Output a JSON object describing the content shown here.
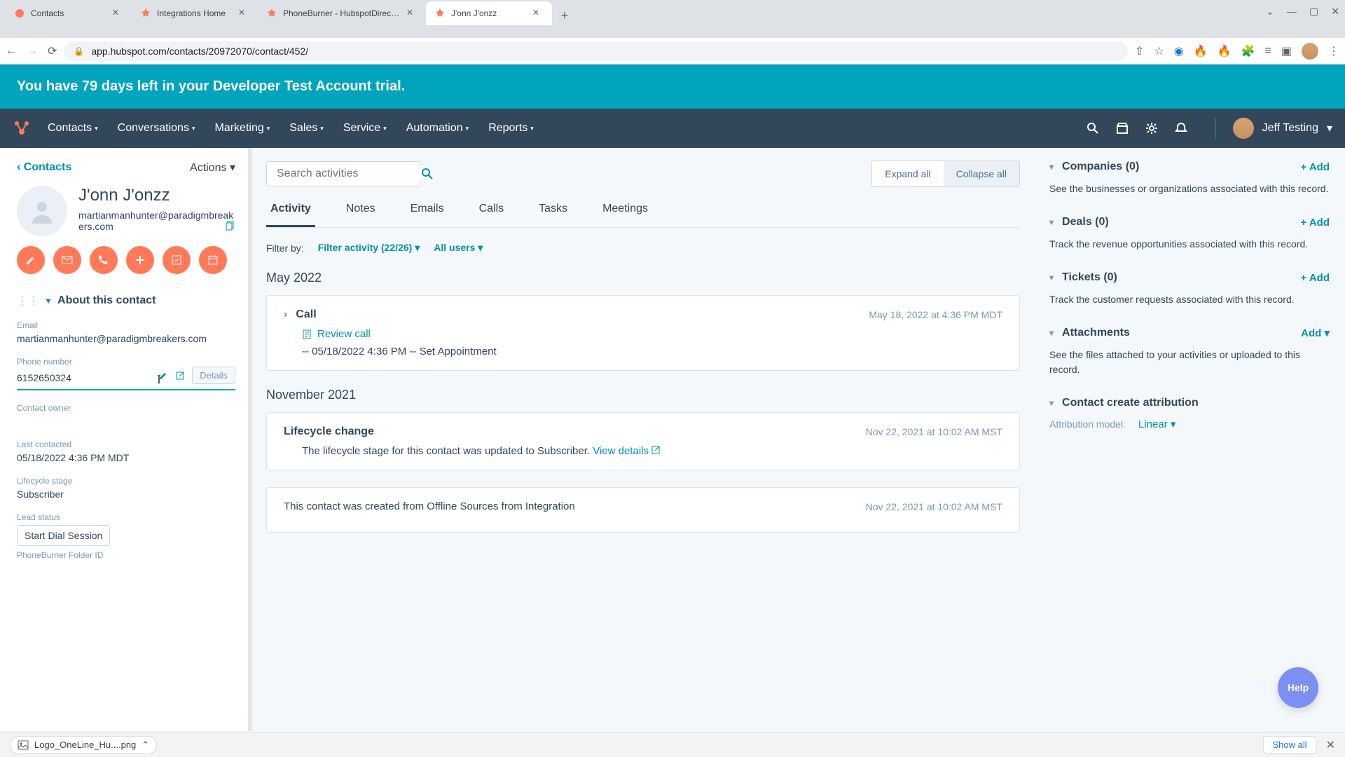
{
  "browser": {
    "tabs": [
      {
        "title": "Contacts"
      },
      {
        "title": "Integrations Home"
      },
      {
        "title": "PhoneBurner - HubspotDirect Ac"
      },
      {
        "title": "J'onn J'onzz"
      }
    ],
    "active_tab": 3,
    "url": "app.hubspot.com/contacts/20972070/contact/452/",
    "download": {
      "file": "Logo_OneLine_Hu....png",
      "show_all": "Show all"
    }
  },
  "banner": "You have 79 days left in your Developer Test Account trial.",
  "nav": {
    "items": [
      "Contacts",
      "Conversations",
      "Marketing",
      "Sales",
      "Service",
      "Automation",
      "Reports"
    ],
    "account": "Jeff Testing"
  },
  "sidebar": {
    "back": "Contacts",
    "actions": "Actions",
    "name": "J'onn J'onzz",
    "email_top": "martianmanhunter@paradigmbreakers.com",
    "about_heading": "About this contact",
    "fields": {
      "email_label": "Email",
      "email_value": "martianmanhunter@paradigmbreakers.com",
      "phone_label": "Phone number",
      "phone_value": "6152650324",
      "details_btn": "Details",
      "owner_label": "Contact owner",
      "last_contacted_label": "Last contacted",
      "last_contacted_value": "05/18/2022 4:36 PM MDT",
      "lifecycle_label": "Lifecycle stage",
      "lifecycle_value": "Subscriber",
      "lead_status_label": "Lead status",
      "dial_btn": "Start Dial Session",
      "folder_label": "PhoneBurner Folder ID"
    }
  },
  "center": {
    "search_placeholder": "Search activities",
    "expand": "Expand all",
    "collapse": "Collapse all",
    "tabs": [
      "Activity",
      "Notes",
      "Emails",
      "Calls",
      "Tasks",
      "Meetings"
    ],
    "filter_label": "Filter by:",
    "filter_activity": "Filter activity (22/26)",
    "all_users": "All users",
    "months": {
      "m1": "May 2022",
      "m2": "November 2021"
    },
    "cards": {
      "call": {
        "title": "Call",
        "date": "May 18, 2022 at 4:36 PM MDT",
        "review": "Review call",
        "body": "-- 05/18/2022 4:36 PM -- Set Appointment"
      },
      "lifecycle": {
        "title": "Lifecycle change",
        "date": "Nov 22, 2021 at 10:02 AM MST",
        "body": "The lifecycle stage for this contact was updated to Subscriber. ",
        "link": "View details"
      },
      "created": {
        "body": "This contact was created from Offline Sources from Integration",
        "date": "Nov 22, 2021 at 10:02 AM MST"
      }
    }
  },
  "rsidebar": {
    "companies": {
      "title": "Companies (0)",
      "add": "+ Add",
      "body": "See the businesses or organizations associated with this record."
    },
    "deals": {
      "title": "Deals (0)",
      "add": "+ Add",
      "body": "Track the revenue opportunities associated with this record."
    },
    "tickets": {
      "title": "Tickets (0)",
      "add": "+ Add",
      "body": "Track the customer requests associated with this record."
    },
    "attachments": {
      "title": "Attachments",
      "add": "Add",
      "body": "See the files attached to your activities or uploaded to this record."
    },
    "attribution": {
      "title": "Contact create attribution",
      "model_label": "Attribution model:",
      "model_value": "Linear"
    }
  },
  "help": "Help"
}
